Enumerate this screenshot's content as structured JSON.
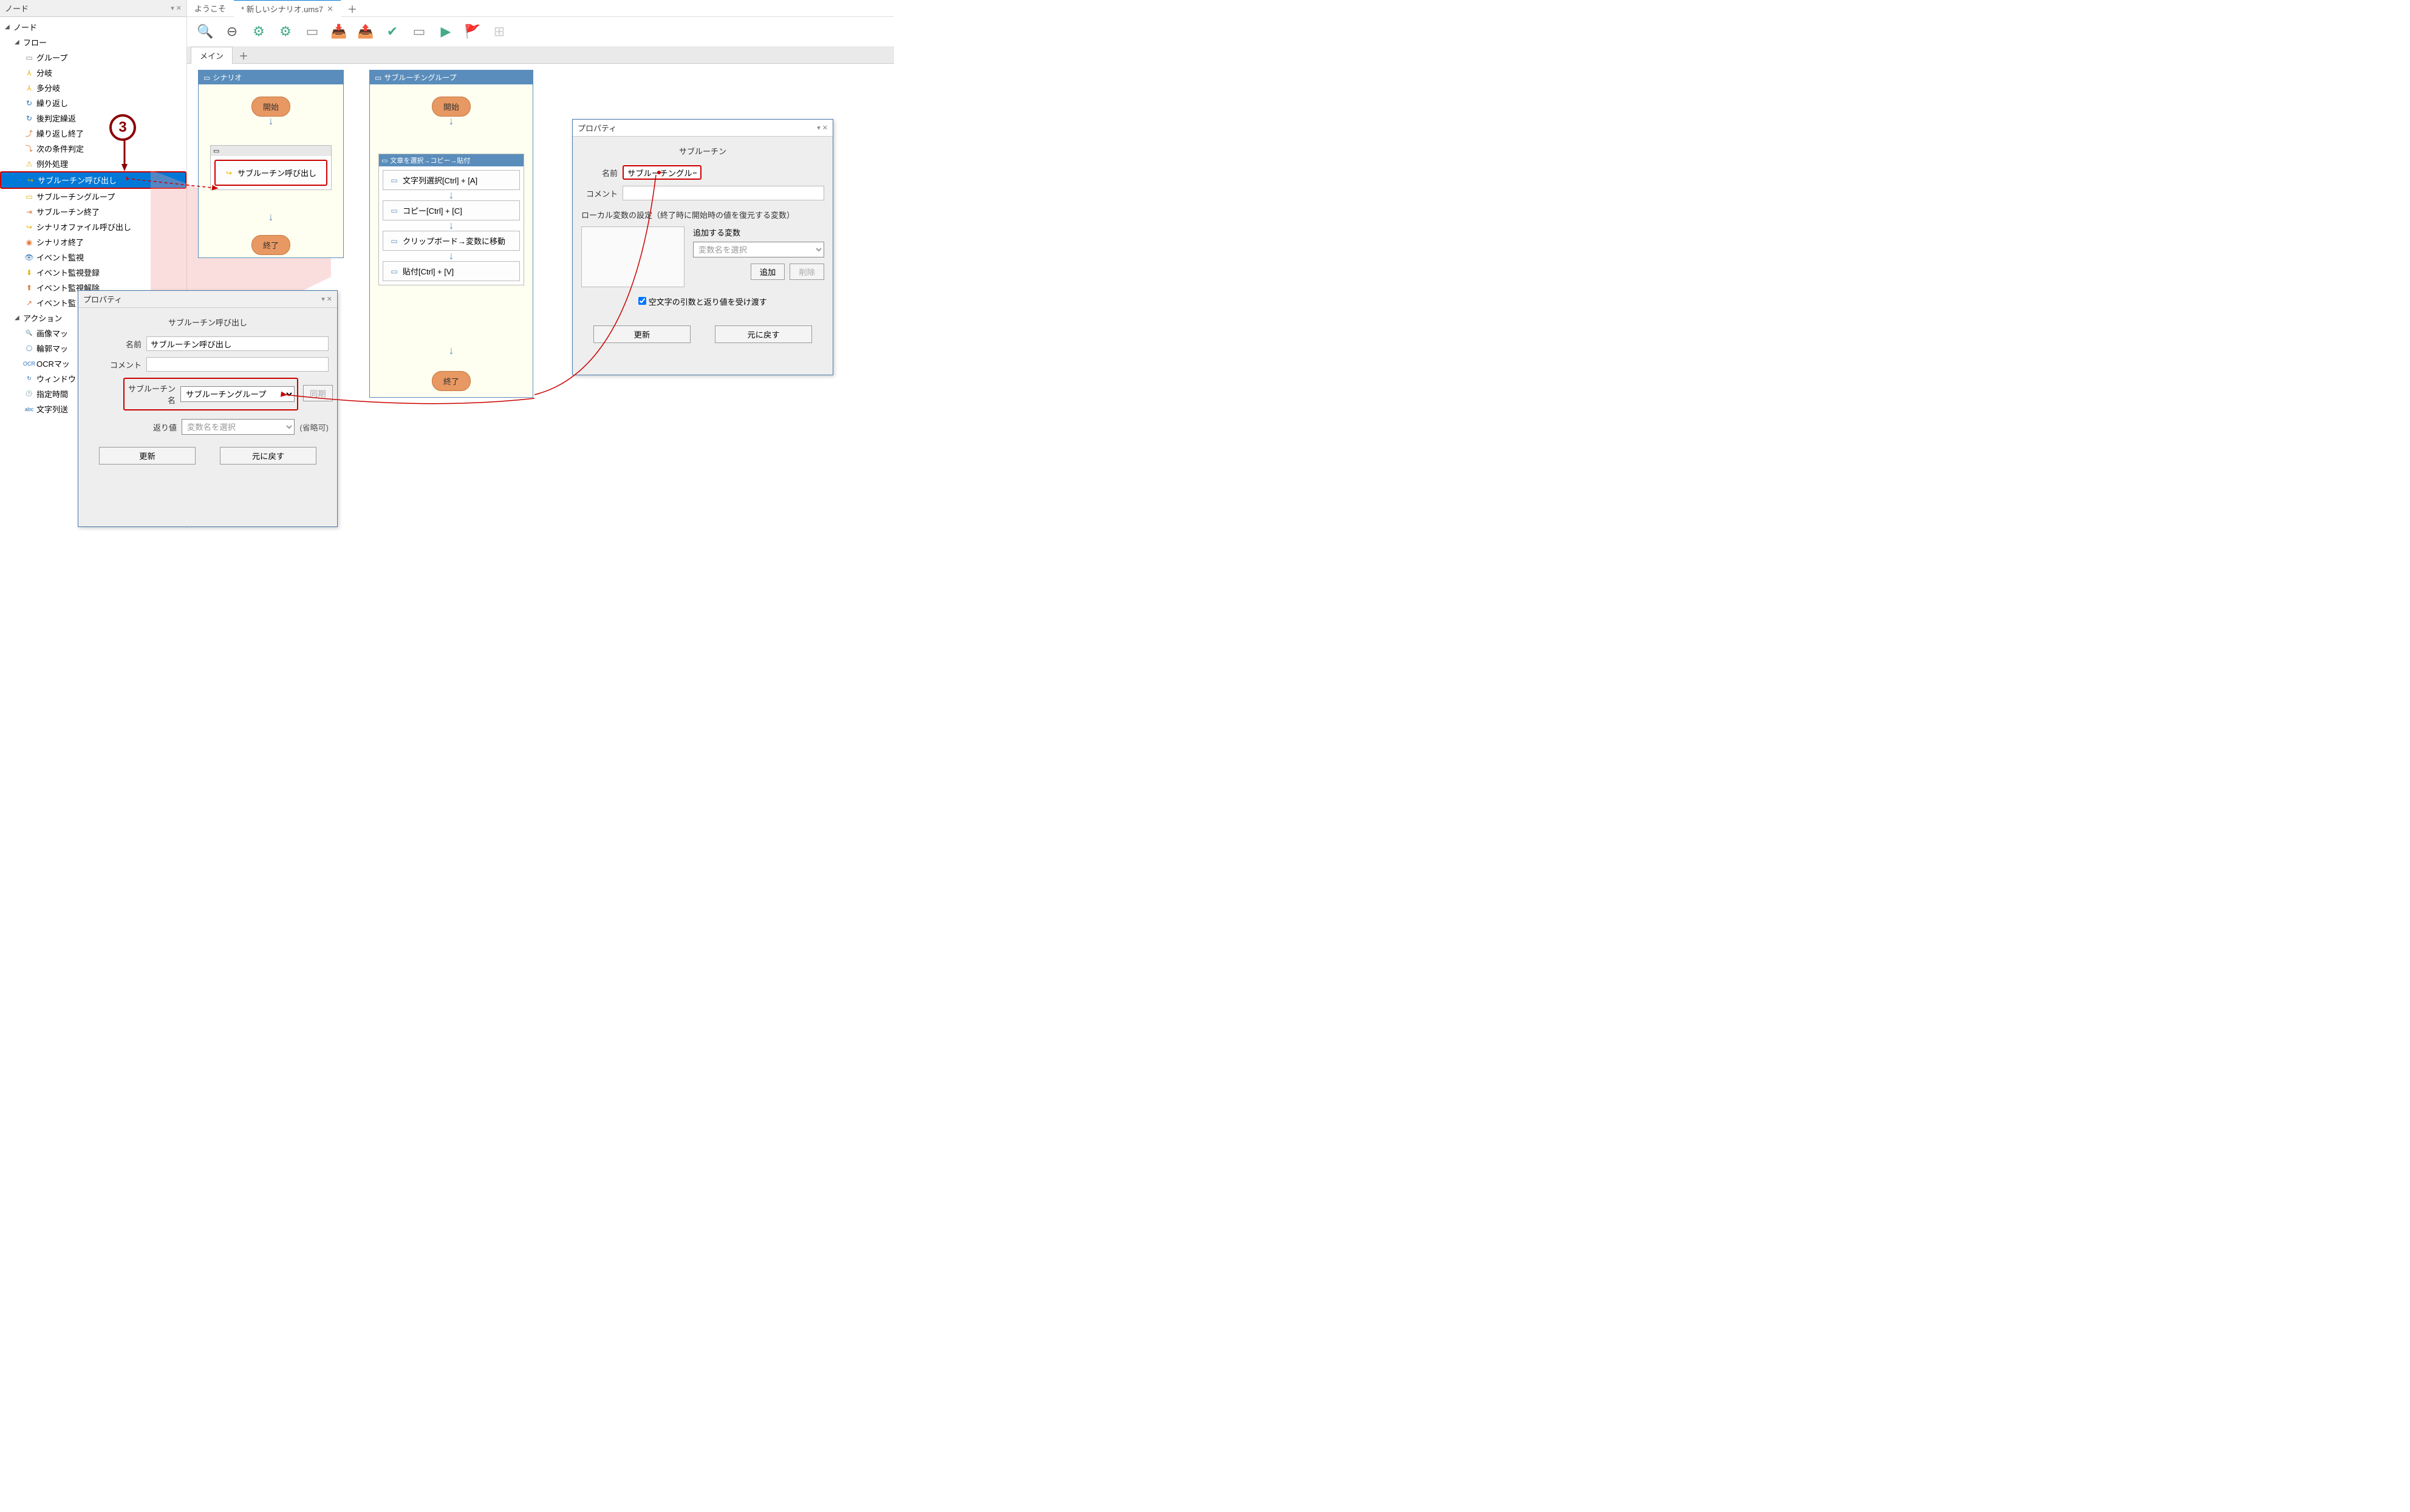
{
  "nodePanel": {
    "title": "ノード",
    "rootLabel": "ノード",
    "flowLabel": "フロー",
    "actionLabel": "アクション",
    "flowItems": [
      {
        "label": "グループ",
        "iconColor": "#888",
        "glyph": "▭"
      },
      {
        "label": "分岐",
        "iconColor": "#e6b000",
        "glyph": "⅄"
      },
      {
        "label": "多分岐",
        "iconColor": "#e6b000",
        "glyph": "⅄"
      },
      {
        "label": "繰り返し",
        "iconColor": "#2a6fb5",
        "glyph": "↻"
      },
      {
        "label": "後判定繰返",
        "iconColor": "#2a6fb5",
        "glyph": "↻"
      },
      {
        "label": "繰り返し終了",
        "iconColor": "#e07a3c",
        "glyph": "⤴"
      },
      {
        "label": "次の条件判定",
        "iconColor": "#e07a3c",
        "glyph": "⤵"
      },
      {
        "label": "例外処理",
        "iconColor": "#e6b000",
        "glyph": "⚠"
      },
      {
        "label": "サブルーチン呼び出し",
        "iconColor": "#e6b000",
        "glyph": "↪",
        "selected": true
      },
      {
        "label": "サブルーチングループ",
        "iconColor": "#e6b000",
        "glyph": "▭"
      },
      {
        "label": "サブルーチン終了",
        "iconColor": "#e07a3c",
        "glyph": "⇥"
      },
      {
        "label": "シナリオファイル呼び出し",
        "iconColor": "#e6b000",
        "glyph": "↪"
      },
      {
        "label": "シナリオ終了",
        "iconColor": "#e07a3c",
        "glyph": "◉"
      },
      {
        "label": "イベント監視",
        "iconColor": "#2a6fb5",
        "glyph": "👁"
      },
      {
        "label": "イベント監視登録",
        "iconColor": "#e6b000",
        "glyph": "⬇"
      },
      {
        "label": "イベント監視解除",
        "iconColor": "#e07a3c",
        "glyph": "⬆"
      },
      {
        "label": "イベント監",
        "iconColor": "#e07a3c",
        "glyph": "↗"
      }
    ],
    "actionItems": [
      {
        "label": "画像マッ",
        "glyph": "🔍"
      },
      {
        "label": "輪郭マッ",
        "glyph": "◯"
      },
      {
        "label": "OCRマッ",
        "glyph": "OCR"
      },
      {
        "label": "ウィンドウ",
        "glyph": "↻"
      },
      {
        "label": "指定時間",
        "glyph": "🕐"
      },
      {
        "label": "文字列送",
        "glyph": "abc"
      }
    ]
  },
  "tabs": {
    "welcome": "ようこそ",
    "scenario": "* 新しいシナリオ.ums7"
  },
  "subtabs": {
    "main": "メイン"
  },
  "canvas": {
    "scenarioGroup": {
      "title": "シナリオ",
      "start": "開始",
      "boxTitle": "",
      "call": "サブルーチン呼び出し",
      "end": "終了"
    },
    "subroutineGroup": {
      "title": "サブルーチングループ",
      "start": "開始",
      "innerTitle": "文章を選択→コピー→貼付",
      "steps": [
        "文字列選択[Ctrl] + [A]",
        "コピー[Ctrl] + [C]",
        "クリップボード→変数に移動",
        "貼付[Ctrl] + [V]"
      ],
      "end": "終了"
    }
  },
  "propLeft": {
    "panelTitle": "プロパティ",
    "title": "サブルーチン呼び出し",
    "nameLabel": "名前",
    "nameValue": "サブルーチン呼び出し",
    "commentLabel": "コメント",
    "subNameLabel": "サブルーチン名",
    "subNameValue": "サブルーチングループ",
    "syncBtn": "同期",
    "returnLabel": "返り値",
    "returnPlaceholder": "変数名を選択",
    "returnNote": "(省略可)",
    "update": "更新",
    "revert": "元に戻す"
  },
  "propRight": {
    "panelTitle": "プロパティ",
    "title": "サブルーチン",
    "nameLabel": "名前",
    "nameValue": "サブルーチングループ",
    "commentLabel": "コメント",
    "localVarHeading": "ローカル変数の設定（終了時に開始時の値を復元する変数）",
    "addVarLabel": "追加する変数",
    "addVarPlaceholder": "変数名を選択",
    "addBtn": "追加",
    "delBtn": "削除",
    "checkboxLabel": "空文字の引数と返り値を受け渡す",
    "update": "更新",
    "revert": "元に戻す"
  },
  "callout": "3"
}
